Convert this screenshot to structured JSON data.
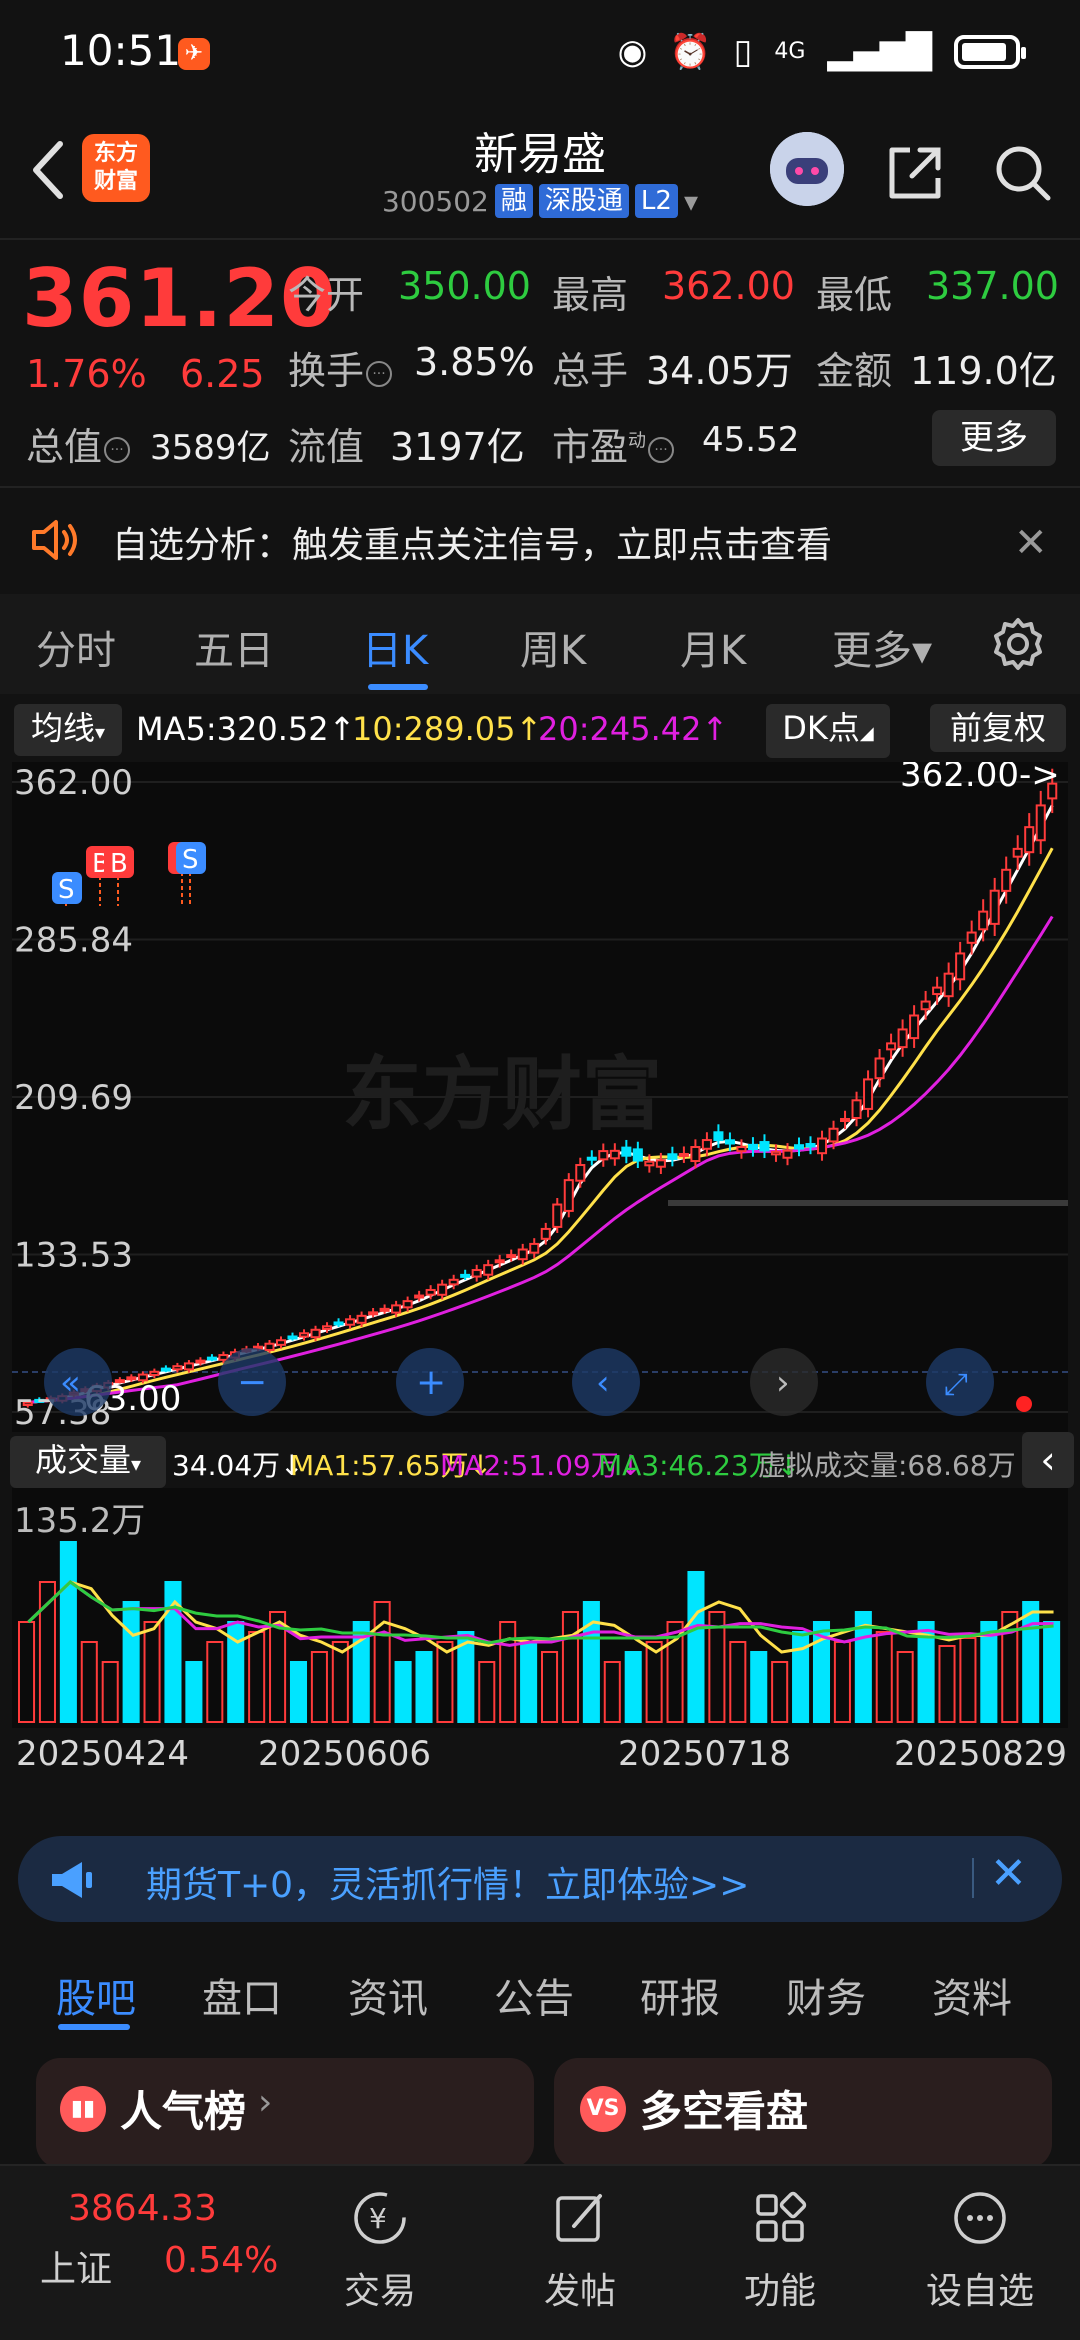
{
  "status_bar": {
    "time": "10:51",
    "network": "4G"
  },
  "header": {
    "logo_text_line1": "东方",
    "logo_text_line2": "财富",
    "stock_name": "新易盛",
    "stock_code": "300502",
    "tags": [
      "融",
      "深股通",
      "L2"
    ]
  },
  "quote": {
    "price": "361.20",
    "change_pct": "1.76%",
    "change_amt": "6.25",
    "open_label": "今开",
    "open": "350.00",
    "high_label": "最高",
    "high": "362.00",
    "low_label": "最低",
    "low": "337.00",
    "turnover_label": "换手",
    "turnover": "3.85%",
    "volume_label": "总手",
    "volume": "34.05万",
    "amount_label": "金额",
    "amount": "119.0亿",
    "mktcap_label": "总值",
    "mktcap": "3589亿",
    "float_label": "流值",
    "float_cap": "3197亿",
    "pe_label": "市盈",
    "pe_sup": "动",
    "pe": "45.52",
    "more_label": "更多",
    "colors": {
      "up": "#ff3b3b",
      "down": "#2ecc40"
    }
  },
  "notice": {
    "text": "自选分析：触发重点关注信号，立即点击查看"
  },
  "period_tabs": [
    {
      "label": "分时",
      "active": false
    },
    {
      "label": "五日",
      "active": false
    },
    {
      "label": "日K",
      "active": true
    },
    {
      "label": "周K",
      "active": false
    },
    {
      "label": "月K",
      "active": false
    },
    {
      "label": "更多▾",
      "active": false
    }
  ],
  "ma_row": {
    "indicator_label": "均线",
    "ma5": "MA5:320.52↑",
    "ma10": "10:289.05↑",
    "ma20": "20:245.42↑",
    "dk_label": "DK点",
    "adjust_label": "前复权"
  },
  "chart_data": {
    "type": "candlestick",
    "y_ticks": [
      "362.00",
      "285.84",
      "209.69",
      "133.53",
      "57.38"
    ],
    "ylim": [
      57.38,
      362.0
    ],
    "high_marker": "362.00->",
    "low_marker": "63.00",
    "watermark": "东方财富",
    "signals": [
      "S",
      "B",
      "B",
      "B",
      "S"
    ],
    "x_dates": [
      "20250424",
      "20250606",
      "20250718",
      "20250829"
    ],
    "close_estimates": [
      62,
      65,
      70,
      74,
      78,
      82,
      86,
      90,
      95,
      100,
      105,
      110,
      118,
      125,
      132,
      140,
      175,
      185,
      178,
      180,
      190,
      185,
      183,
      186,
      200,
      230,
      250,
      270,
      300,
      330,
      361.2
    ],
    "series": [
      {
        "name": "MA5",
        "color": "#ffffff"
      },
      {
        "name": "MA10",
        "color": "#ffe14a"
      },
      {
        "name": "MA20",
        "color": "#e020e0"
      }
    ]
  },
  "volume_row": {
    "label": "成交量",
    "vol": "34.04万↓",
    "ma1": "MA1:57.65万↓",
    "ma2": "MA2:51.09万↓",
    "ma3": "MA3:46.23万↓",
    "virtual": "虚拟成交量:68.68万",
    "max_label": "135.2万"
  },
  "volume_data": [
    0.5,
    0.7,
    0.9,
    0.4,
    0.3,
    0.6,
    0.5,
    0.7,
    0.3,
    0.4,
    0.5,
    0.45,
    0.55,
    0.3,
    0.35,
    0.4,
    0.5,
    0.6,
    0.3,
    0.35,
    0.4,
    0.45,
    0.3,
    0.5,
    0.4,
    0.35,
    0.55,
    0.6,
    0.3,
    0.35,
    0.4,
    0.5,
    0.75,
    0.55,
    0.4,
    0.35,
    0.3,
    0.45,
    0.5,
    0.4,
    0.55,
    0.45,
    0.35,
    0.5,
    0.38,
    0.42,
    0.5,
    0.55,
    0.6,
    0.5
  ],
  "ad": {
    "text": "期货T+0，灵活抓行情！立即体验>>"
  },
  "sub_tabs": [
    "股吧",
    "盘口",
    "资讯",
    "公告",
    "研报",
    "财务",
    "资料"
  ],
  "cards": [
    {
      "icon": "▮▮",
      "title": "人气榜"
    },
    {
      "icon": "VS",
      "title": "多空看盘"
    }
  ],
  "bottom_nav": {
    "index_value": "3864.33",
    "index_name": "上证",
    "index_change": "0.54%",
    "items": [
      "交易",
      "发帖",
      "功能",
      "设自选"
    ]
  }
}
